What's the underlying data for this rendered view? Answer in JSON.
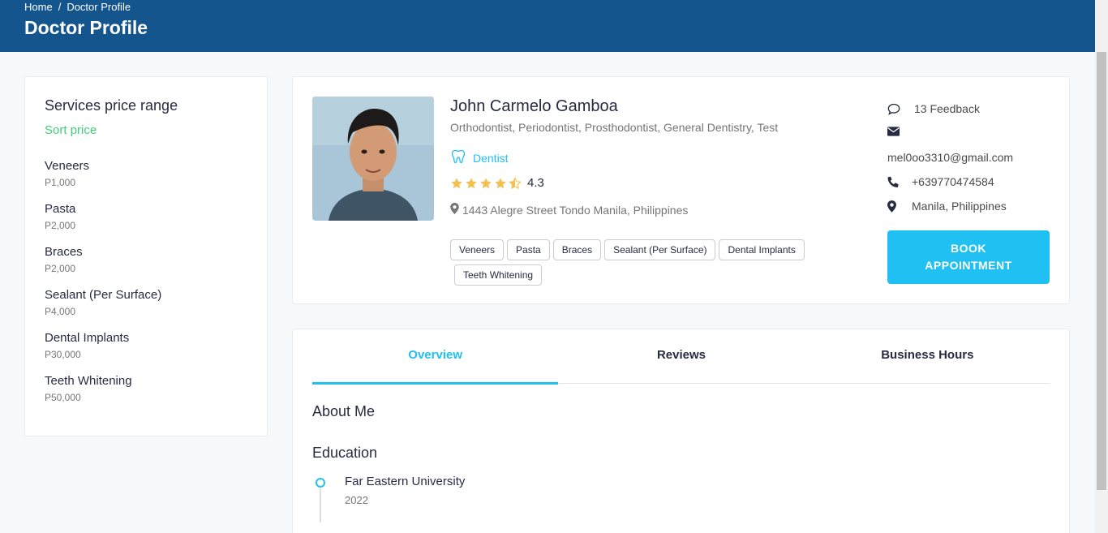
{
  "header": {
    "breadcrumb": [
      "Home",
      "Doctor Profile"
    ],
    "breadcrumb_sep": "/",
    "title": "Doctor Profile"
  },
  "sidebar": {
    "title": "Services price range",
    "sort_label": "Sort price",
    "services": [
      {
        "name": "Veneers",
        "price": "P1,000"
      },
      {
        "name": "Pasta",
        "price": "P2,000"
      },
      {
        "name": "Braces",
        "price": "P2,000"
      },
      {
        "name": "Sealant (Per Surface)",
        "price": "P4,000"
      },
      {
        "name": "Dental Implants",
        "price": "P30,000"
      },
      {
        "name": "Teeth Whitening",
        "price": "P50,000"
      }
    ]
  },
  "doctor": {
    "name": "John Carmelo Gamboa",
    "specialties": "Orthodontist, Periodontist, Prosthodontist, General Dentistry, Test",
    "department": "Dentist",
    "rating": "4.3",
    "rating_value": 4.3,
    "address": "1443 Alegre Street Tondo Manila, Philippines",
    "tags": [
      "Veneers",
      "Pasta",
      "Braces",
      "Sealant (Per Surface)",
      "Dental Implants",
      "Teeth Whitening"
    ]
  },
  "contact": {
    "feedback": "13 Feedback",
    "email": "mel0oo3310@gmail.com",
    "phone": "+639770474584",
    "location": "Manila, Philippines",
    "book_label_1": "BOOK",
    "book_label_2": "APPOINTMENT"
  },
  "tabs": {
    "items": [
      "Overview",
      "Reviews",
      "Business Hours"
    ],
    "active": "Overview"
  },
  "overview": {
    "about_title": "About Me",
    "education_title": "Education",
    "education": [
      {
        "school": "Far Eastern University",
        "year": "2022"
      }
    ]
  },
  "colors": {
    "header_bg": "#15558d",
    "accent": "#20c0f3",
    "sort_green": "#3fcf7a",
    "star": "#f4c150"
  }
}
